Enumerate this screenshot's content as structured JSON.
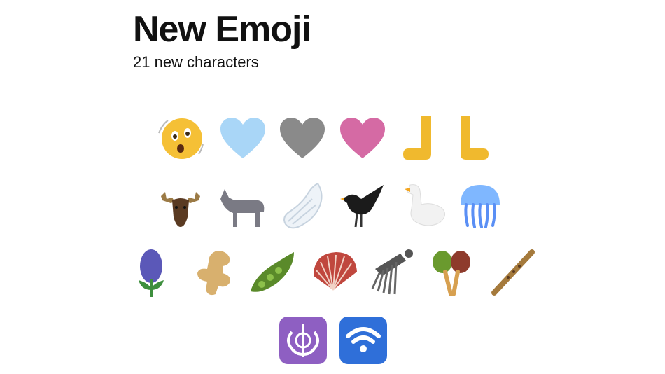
{
  "header": {
    "title": "New Emoji",
    "subtitle": "21 new characters"
  },
  "emoji": [
    [
      "face-with-open-eyes-and-hand-over-mouth",
      "light-blue-heart",
      "grey-heart",
      "pink-heart",
      "leftwards-pushing-hand",
      "rightwards-pushing-hand"
    ],
    [
      "moose",
      "donkey",
      "wing",
      "black-bird",
      "goose",
      "jellyfish"
    ],
    [
      "hyacinth",
      "ginger-root",
      "pea-pod",
      "folding-hand-fan",
      "hair-pick",
      "maracas",
      "flute"
    ],
    [
      "khanda",
      "wireless"
    ]
  ],
  "colors": {
    "face_yellow": "#f5c036",
    "light_blue_heart": "#a9d6f7",
    "grey_heart": "#8a8a8a",
    "pink_heart": "#d56aa4",
    "hand_yellow": "#f0b92e",
    "symbol_purple": "#8e5fc2",
    "symbol_blue": "#2f6fd9"
  }
}
